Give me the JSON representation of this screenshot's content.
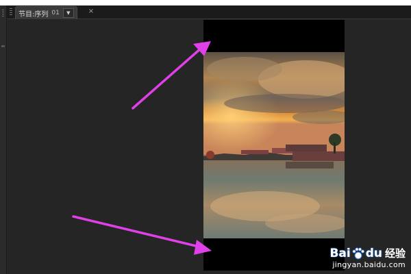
{
  "panel": {
    "tab_title": "节目:序列",
    "tab_sequence": "01",
    "tab_close": "×"
  },
  "icons": {
    "dropdown": "chevron-down-icon",
    "close": "close-icon",
    "grip": "grip-icon",
    "watermark_paw": "paw-icon"
  },
  "watermark": {
    "brand_left": "Bai",
    "brand_right": "du",
    "jingyan": "经验",
    "url": "jingyan.baidu.com"
  },
  "colors": {
    "background": "#232323",
    "letterbox": "#000000",
    "annotation_arrow": "#e040e8"
  }
}
